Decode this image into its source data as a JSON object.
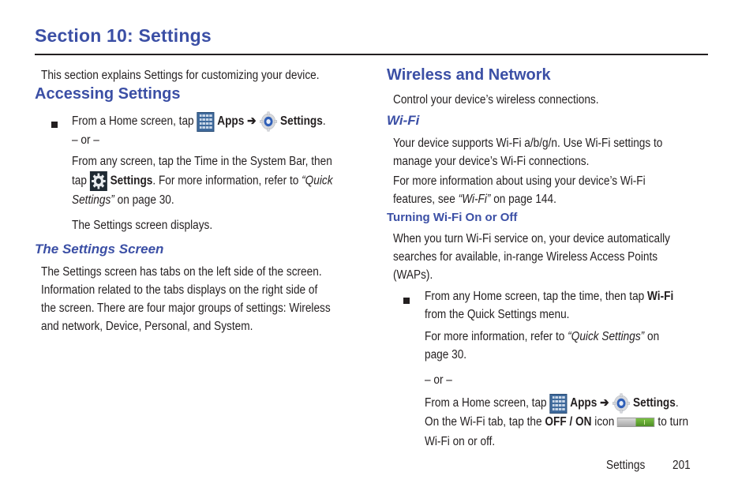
{
  "page": {
    "section_title": "Section 10: Settings",
    "footer": {
      "label": "Settings",
      "page_number": "201"
    }
  },
  "left": {
    "intro": "This section explains Settings for customizing your device.",
    "accessing": {
      "heading": "Accessing Settings",
      "step1_prefix": "From a Home screen, tap",
      "apps_label": "Apps",
      "arrow": "➔",
      "settings_label": "Settings",
      "period": ".",
      "or": "– or –",
      "alt_line1": "From any screen, tap the Time in the System Bar, then",
      "alt_tap": "tap",
      "alt_settings": "Settings",
      "alt_rest": ". For more information, refer to",
      "alt_ref_part1": "“Quick",
      "alt_ref_part2": "Settings”",
      "alt_page": " on page 30.",
      "result": "The Settings screen displays."
    },
    "settings_screen": {
      "heading": "The Settings Screen",
      "lines": [
        "The Settings screen has tabs on the left side of the screen.",
        "Information related to the tabs displays on the right side of",
        "the screen. There are four major groups of settings: Wireless",
        "and network, Device, Personal, and System."
      ]
    }
  },
  "right": {
    "wireless": {
      "heading": "Wireless and Network",
      "intro": "Control your device’s wireless connections."
    },
    "wifi": {
      "heading": "Wi-Fi",
      "p1_lines": [
        "Your device supports Wi-Fi a/b/g/n. Use Wi-Fi settings to",
        "manage your device’s Wi-Fi connections."
      ],
      "p2_line1": "For more information about using your device’s Wi-Fi",
      "p2_prefix": "features, see ",
      "p2_ref": "“Wi-Fi”",
      "p2_suffix": " on page 144."
    },
    "turning": {
      "heading": "Turning Wi-Fi On or Off",
      "p_lines": [
        "When you turn Wi-Fi service on, your device automatically",
        "searches for available, in-range Wireless Access Points",
        "(WAPs)."
      ],
      "step_prefix": "From any Home screen, tap the time, then tap ",
      "step_bold": "Wi-Fi",
      "step_line2": "from the Quick Settings menu.",
      "ref_prefix": "For more information, refer to ",
      "ref_italic": "“Quick Settings”",
      "ref_suffix": "  on",
      "ref_line2": "page 30.",
      "or": "– or –",
      "alt_prefix": "From a Home screen, tap",
      "apps_label": "Apps",
      "arrow": "➔",
      "settings_label": "Settings",
      "period": ".",
      "tab_prefix": "On the Wi-Fi tab, tap the ",
      "tab_bold": "OFF / ON",
      "tab_mid": " icon",
      "tab_suffix": " to turn",
      "tab_line2": "Wi-Fi on or off."
    }
  },
  "colors": {
    "heading_blue": "#3b4fa5",
    "text": "#231f20",
    "toggle_on": "#5ea52e"
  }
}
